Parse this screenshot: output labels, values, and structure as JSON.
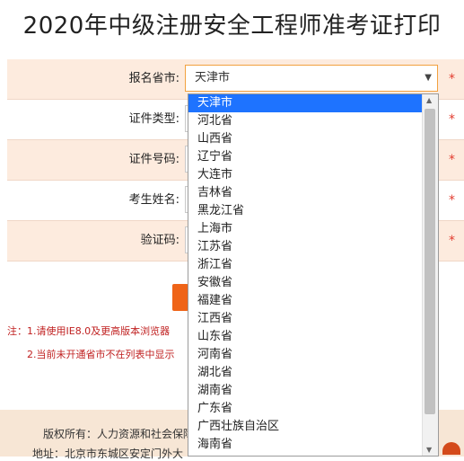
{
  "page": {
    "title": "2020年中级注册安全工程师准考证打印"
  },
  "form": {
    "province_label": "报名省市:",
    "province_value": "天津市",
    "id_type_label": "证件类型:",
    "id_number_label": "证件号码:",
    "name_label": "考生姓名:",
    "captcha_label": "验证码:",
    "required_mark": "*"
  },
  "notes": {
    "line1": "注：1.请使用IE8.0及更高版本浏览器",
    "line2": "2.当前未开通省市不在列表中显示"
  },
  "footer": {
    "copyright": "版权所有：人力资源和社会保障",
    "address": "地址：北京市东城区安定门外大"
  },
  "dropdown": {
    "selected_index": 0,
    "options": [
      "天津市",
      "河北省",
      "山西省",
      "辽宁省",
      "大连市",
      "吉林省",
      "黑龙江省",
      "上海市",
      "江苏省",
      "浙江省",
      "安徽省",
      "福建省",
      "江西省",
      "山东省",
      "河南省",
      "湖北省",
      "湖南省",
      "广东省",
      "广西壮族自治区",
      "海南省"
    ]
  },
  "colors": {
    "accent": "#ef6418",
    "selection": "#1e73ff",
    "required": "#e23b2e",
    "shade": "#fdebde"
  }
}
